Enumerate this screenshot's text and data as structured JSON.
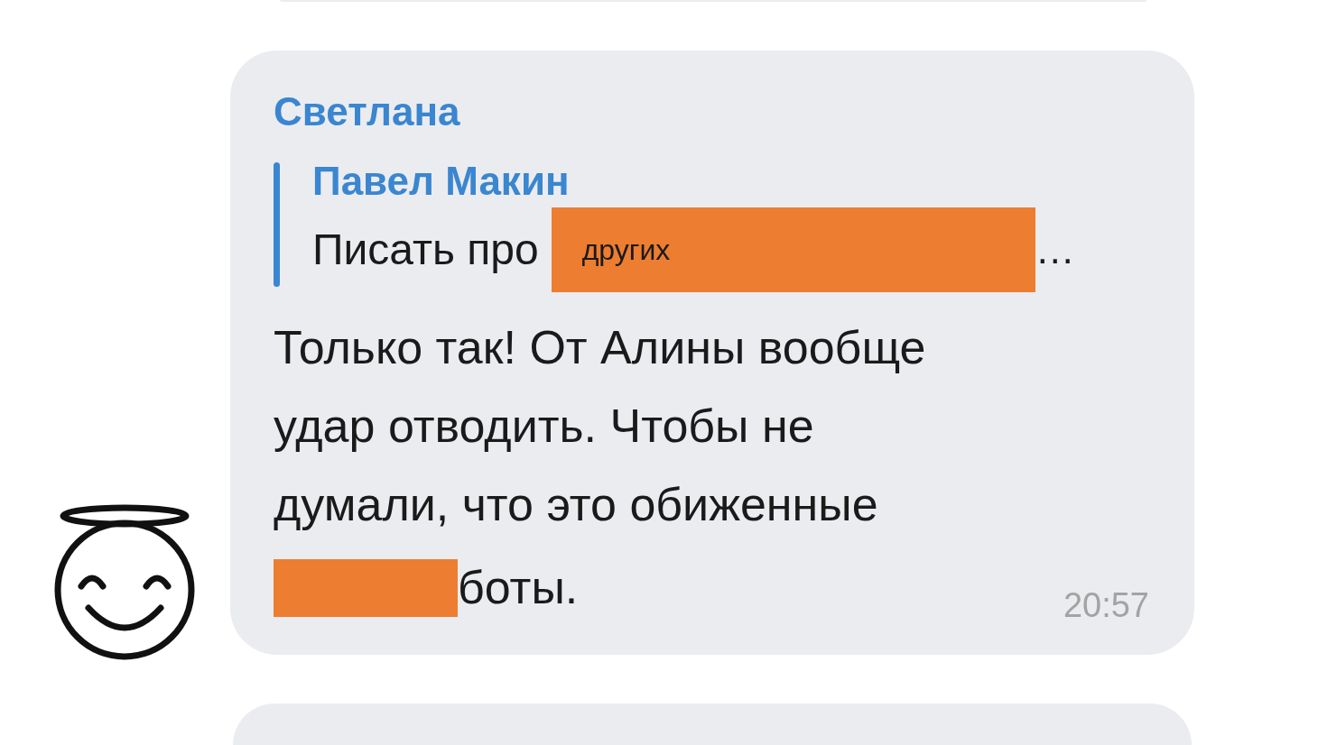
{
  "message": {
    "sender": "Светлана",
    "reply": {
      "author": "Павел Макин",
      "text": "Писать про",
      "redaction_label": "других",
      "ellipsis": "…"
    },
    "lines": [
      "Только так! От Алины вообще",
      "удар отводить. Чтобы не",
      "думали, что это обиженные"
    ],
    "after_redaction": "боты.",
    "time": "20:57"
  }
}
